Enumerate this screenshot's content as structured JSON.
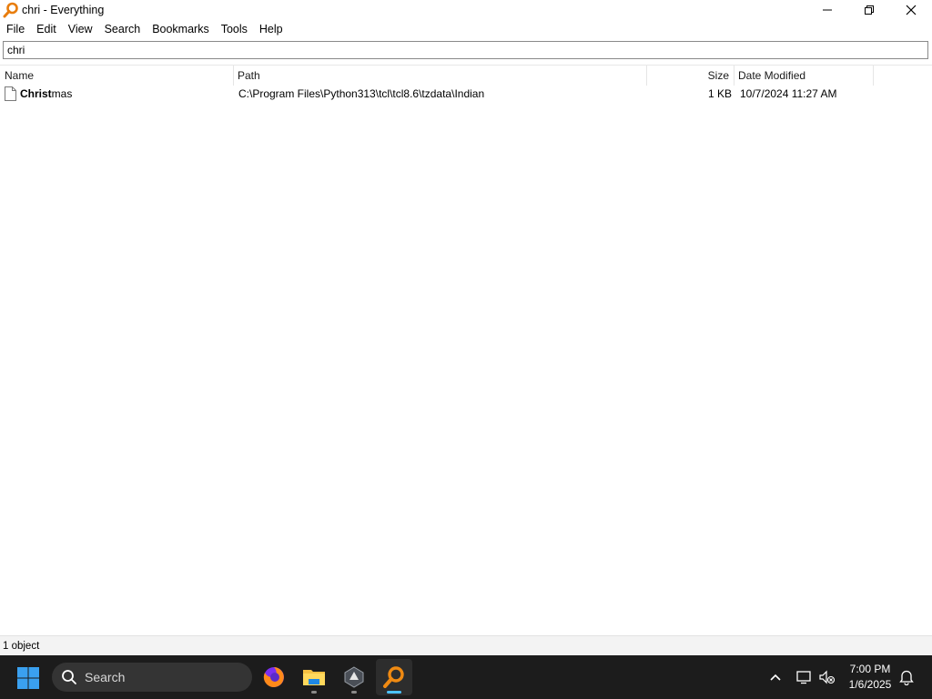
{
  "window": {
    "title": "chri - Everything",
    "app_icon": "everything-magnifier-icon"
  },
  "menu": [
    "File",
    "Edit",
    "View",
    "Search",
    "Bookmarks",
    "Tools",
    "Help"
  ],
  "search": {
    "value": "chri"
  },
  "columns": [
    "Name",
    "Path",
    "Size",
    "Date Modified"
  ],
  "results": [
    {
      "name_match": "Christ",
      "name_rest": "mas",
      "path": "C:\\Program Files\\Python313\\tcl\\tcl8.6\\tzdata\\Indian",
      "size": "1 KB",
      "date_modified": "10/7/2024 11:27 AM",
      "icon": "file-icon"
    }
  ],
  "status": {
    "count": "1 object"
  },
  "taskbar": {
    "search_label": "Search",
    "apps": [
      "firefox-icon",
      "file-explorer-icon",
      "app-icon",
      "everything-icon"
    ],
    "active_app": "everything-icon",
    "time": "7:00 PM",
    "date": "1/6/2025"
  },
  "colors": {
    "accent": "#e87d0d",
    "taskbar_bg": "#1c1c1c",
    "taskbar_active_indicator": "#4cc2ff"
  }
}
